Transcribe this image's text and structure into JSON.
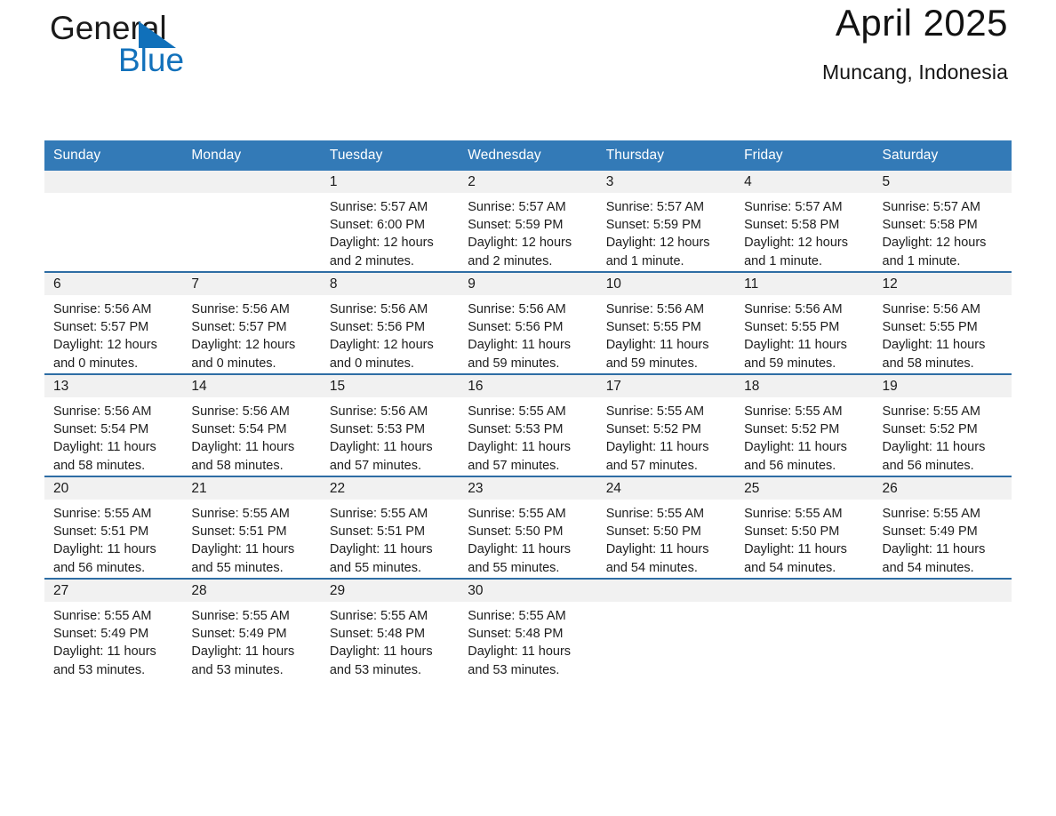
{
  "brand": {
    "name_top": "General",
    "name_bottom": "Blue",
    "triangle_color": "#1070ba",
    "text_color": "#1b1b1b",
    "blue_color": "#1271bb",
    "icon": "triangle-logo-icon"
  },
  "header": {
    "title": "April 2025",
    "subtitle": "Muncang, Indonesia"
  },
  "colors": {
    "header_bg": "#337ab7",
    "row_divider": "#2e6da4",
    "daynum_band": "#f1f1f1",
    "text": "#1a1a1a"
  },
  "calendar": {
    "weekday_headers": [
      "Sunday",
      "Monday",
      "Tuesday",
      "Wednesday",
      "Thursday",
      "Friday",
      "Saturday"
    ],
    "weeks": [
      [
        {
          "day": "",
          "lines": []
        },
        {
          "day": "",
          "lines": []
        },
        {
          "day": "1",
          "lines": [
            "Sunrise: 5:57 AM",
            "Sunset: 6:00 PM",
            "Daylight: 12 hours",
            "and 2 minutes."
          ]
        },
        {
          "day": "2",
          "lines": [
            "Sunrise: 5:57 AM",
            "Sunset: 5:59 PM",
            "Daylight: 12 hours",
            "and 2 minutes."
          ]
        },
        {
          "day": "3",
          "lines": [
            "Sunrise: 5:57 AM",
            "Sunset: 5:59 PM",
            "Daylight: 12 hours",
            "and 1 minute."
          ]
        },
        {
          "day": "4",
          "lines": [
            "Sunrise: 5:57 AM",
            "Sunset: 5:58 PM",
            "Daylight: 12 hours",
            "and 1 minute."
          ]
        },
        {
          "day": "5",
          "lines": [
            "Sunrise: 5:57 AM",
            "Sunset: 5:58 PM",
            "Daylight: 12 hours",
            "and 1 minute."
          ]
        }
      ],
      [
        {
          "day": "6",
          "lines": [
            "Sunrise: 5:56 AM",
            "Sunset: 5:57 PM",
            "Daylight: 12 hours",
            "and 0 minutes."
          ]
        },
        {
          "day": "7",
          "lines": [
            "Sunrise: 5:56 AM",
            "Sunset: 5:57 PM",
            "Daylight: 12 hours",
            "and 0 minutes."
          ]
        },
        {
          "day": "8",
          "lines": [
            "Sunrise: 5:56 AM",
            "Sunset: 5:56 PM",
            "Daylight: 12 hours",
            "and 0 minutes."
          ]
        },
        {
          "day": "9",
          "lines": [
            "Sunrise: 5:56 AM",
            "Sunset: 5:56 PM",
            "Daylight: 11 hours",
            "and 59 minutes."
          ]
        },
        {
          "day": "10",
          "lines": [
            "Sunrise: 5:56 AM",
            "Sunset: 5:55 PM",
            "Daylight: 11 hours",
            "and 59 minutes."
          ]
        },
        {
          "day": "11",
          "lines": [
            "Sunrise: 5:56 AM",
            "Sunset: 5:55 PM",
            "Daylight: 11 hours",
            "and 59 minutes."
          ]
        },
        {
          "day": "12",
          "lines": [
            "Sunrise: 5:56 AM",
            "Sunset: 5:55 PM",
            "Daylight: 11 hours",
            "and 58 minutes."
          ]
        }
      ],
      [
        {
          "day": "13",
          "lines": [
            "Sunrise: 5:56 AM",
            "Sunset: 5:54 PM",
            "Daylight: 11 hours",
            "and 58 minutes."
          ]
        },
        {
          "day": "14",
          "lines": [
            "Sunrise: 5:56 AM",
            "Sunset: 5:54 PM",
            "Daylight: 11 hours",
            "and 58 minutes."
          ]
        },
        {
          "day": "15",
          "lines": [
            "Sunrise: 5:56 AM",
            "Sunset: 5:53 PM",
            "Daylight: 11 hours",
            "and 57 minutes."
          ]
        },
        {
          "day": "16",
          "lines": [
            "Sunrise: 5:55 AM",
            "Sunset: 5:53 PM",
            "Daylight: 11 hours",
            "and 57 minutes."
          ]
        },
        {
          "day": "17",
          "lines": [
            "Sunrise: 5:55 AM",
            "Sunset: 5:52 PM",
            "Daylight: 11 hours",
            "and 57 minutes."
          ]
        },
        {
          "day": "18",
          "lines": [
            "Sunrise: 5:55 AM",
            "Sunset: 5:52 PM",
            "Daylight: 11 hours",
            "and 56 minutes."
          ]
        },
        {
          "day": "19",
          "lines": [
            "Sunrise: 5:55 AM",
            "Sunset: 5:52 PM",
            "Daylight: 11 hours",
            "and 56 minutes."
          ]
        }
      ],
      [
        {
          "day": "20",
          "lines": [
            "Sunrise: 5:55 AM",
            "Sunset: 5:51 PM",
            "Daylight: 11 hours",
            "and 56 minutes."
          ]
        },
        {
          "day": "21",
          "lines": [
            "Sunrise: 5:55 AM",
            "Sunset: 5:51 PM",
            "Daylight: 11 hours",
            "and 55 minutes."
          ]
        },
        {
          "day": "22",
          "lines": [
            "Sunrise: 5:55 AM",
            "Sunset: 5:51 PM",
            "Daylight: 11 hours",
            "and 55 minutes."
          ]
        },
        {
          "day": "23",
          "lines": [
            "Sunrise: 5:55 AM",
            "Sunset: 5:50 PM",
            "Daylight: 11 hours",
            "and 55 minutes."
          ]
        },
        {
          "day": "24",
          "lines": [
            "Sunrise: 5:55 AM",
            "Sunset: 5:50 PM",
            "Daylight: 11 hours",
            "and 54 minutes."
          ]
        },
        {
          "day": "25",
          "lines": [
            "Sunrise: 5:55 AM",
            "Sunset: 5:50 PM",
            "Daylight: 11 hours",
            "and 54 minutes."
          ]
        },
        {
          "day": "26",
          "lines": [
            "Sunrise: 5:55 AM",
            "Sunset: 5:49 PM",
            "Daylight: 11 hours",
            "and 54 minutes."
          ]
        }
      ],
      [
        {
          "day": "27",
          "lines": [
            "Sunrise: 5:55 AM",
            "Sunset: 5:49 PM",
            "Daylight: 11 hours",
            "and 53 minutes."
          ]
        },
        {
          "day": "28",
          "lines": [
            "Sunrise: 5:55 AM",
            "Sunset: 5:49 PM",
            "Daylight: 11 hours",
            "and 53 minutes."
          ]
        },
        {
          "day": "29",
          "lines": [
            "Sunrise: 5:55 AM",
            "Sunset: 5:48 PM",
            "Daylight: 11 hours",
            "and 53 minutes."
          ]
        },
        {
          "day": "30",
          "lines": [
            "Sunrise: 5:55 AM",
            "Sunset: 5:48 PM",
            "Daylight: 11 hours",
            "and 53 minutes."
          ]
        },
        {
          "day": "",
          "lines": []
        },
        {
          "day": "",
          "lines": []
        },
        {
          "day": "",
          "lines": []
        }
      ]
    ]
  }
}
